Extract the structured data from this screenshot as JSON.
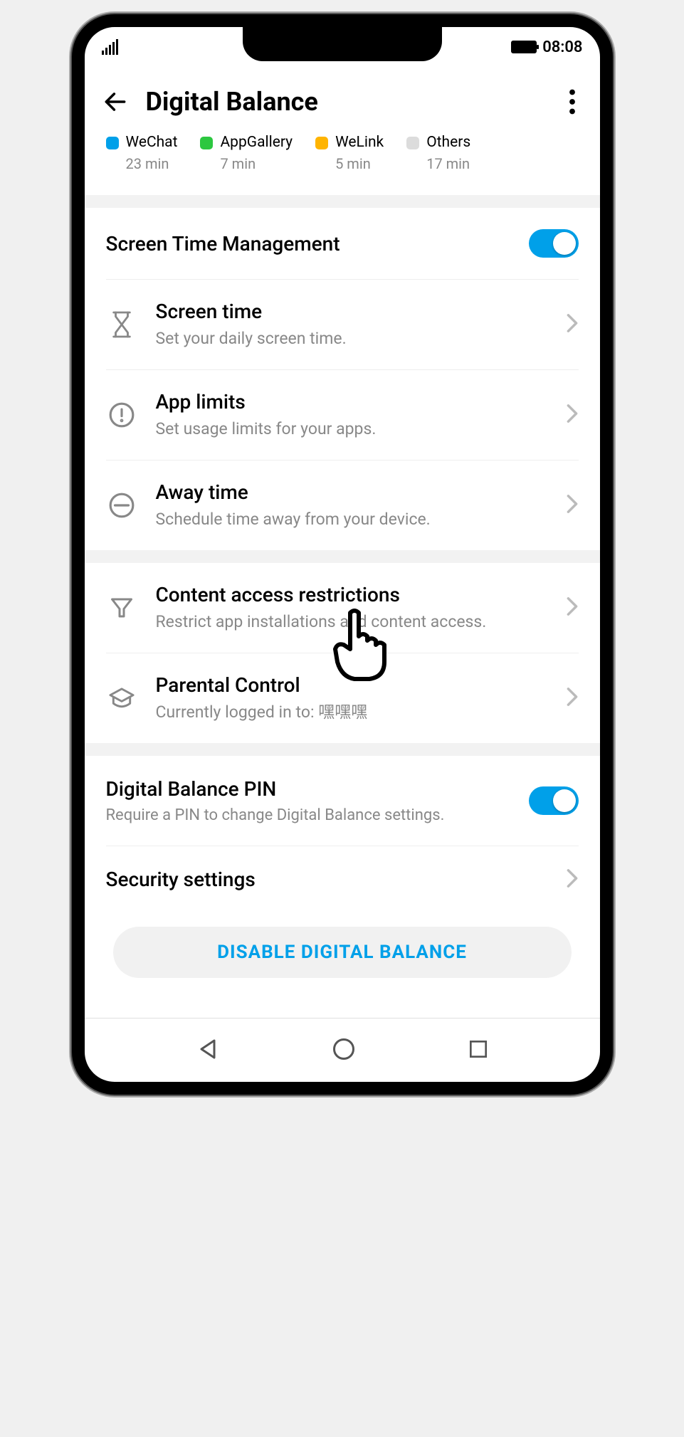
{
  "status": {
    "time": "08:08"
  },
  "header": {
    "title": "Digital Balance"
  },
  "legend": [
    {
      "name": "WeChat",
      "time": "23 min",
      "color": "#00a0e9"
    },
    {
      "name": "AppGallery",
      "time": "7 min",
      "color": "#2cc740"
    },
    {
      "name": "WeLink",
      "time": "5 min",
      "color": "#ffb400"
    },
    {
      "name": "Others",
      "time": "17 min",
      "color": "#dcdcdc"
    }
  ],
  "screen_time_mgmt": {
    "title": "Screen Time Management"
  },
  "items1": [
    {
      "title": "Screen time",
      "sub": "Set your daily screen time."
    },
    {
      "title": "App limits",
      "sub": "Set usage limits for your apps."
    },
    {
      "title": "Away time",
      "sub": "Schedule time away from your device."
    }
  ],
  "items2": [
    {
      "title": "Content access restrictions",
      "sub": "Restrict app installations and content access."
    },
    {
      "title": "Parental Control",
      "sub": "Currently logged in to: 嘿嘿嘿"
    }
  ],
  "pin": {
    "title": "Digital Balance PIN",
    "sub": "Require a PIN to change Digital Balance settings."
  },
  "security": {
    "title": "Security settings"
  },
  "disable": "DISABLE DIGITAL BALANCE"
}
